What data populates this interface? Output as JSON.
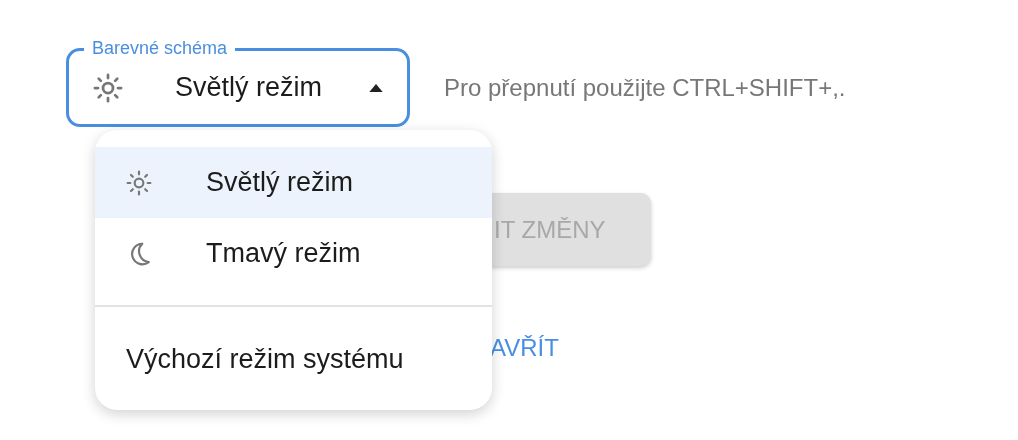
{
  "theme_select": {
    "label": "Barevné schéma",
    "value": "Světlý režim",
    "expanded": true
  },
  "hint": "Pro přepnutí použijte CTRL+SHIFT+,.",
  "save_button": {
    "label": "IT ZMĚNY",
    "disabled": true
  },
  "close_link": {
    "label": "AVŘÍT"
  },
  "menu": {
    "sections": [
      {
        "items": [
          {
            "label": "Světlý režim",
            "kind": "light",
            "selected": true
          },
          {
            "label": "Tmavý režim",
            "kind": "dark",
            "selected": false
          }
        ]
      },
      {
        "items": [
          {
            "label": "Výchozí režim systému",
            "kind": "system",
            "selected": false
          }
        ]
      }
    ]
  }
}
